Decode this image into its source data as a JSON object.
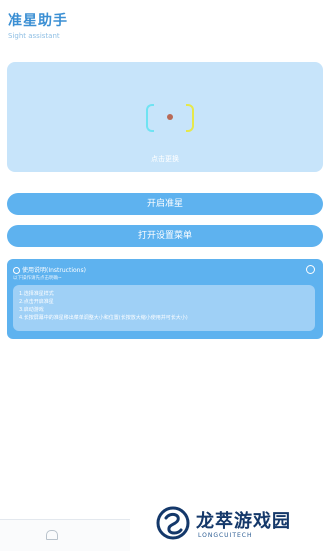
{
  "header": {
    "title": "准星助手",
    "subtitle": "Sight assistant"
  },
  "preview": {
    "label": "点击更换"
  },
  "buttons": {
    "start": "开启准星",
    "settings": "打开设置菜单"
  },
  "instructions": {
    "title": "使用说明(Instructions)",
    "subtitle": "以下操作请先点击明确~",
    "steps": [
      "1.选择准星样式",
      "2.点击开启准星",
      "3.启动游戏",
      "4.长按屏幕中的准星移出菜单调整大小和位置(长按放大缩小使用并可长大小)"
    ]
  },
  "watermark": {
    "title": "龙萃游戏园",
    "sub": "LONGCUITECH"
  },
  "colors": {
    "accent": "#5eb2ef",
    "panel": "#c7e4fa",
    "title": "#3b8fd3"
  },
  "icons": {
    "home": "home-icon",
    "crosshair": "crosshair-icon"
  }
}
